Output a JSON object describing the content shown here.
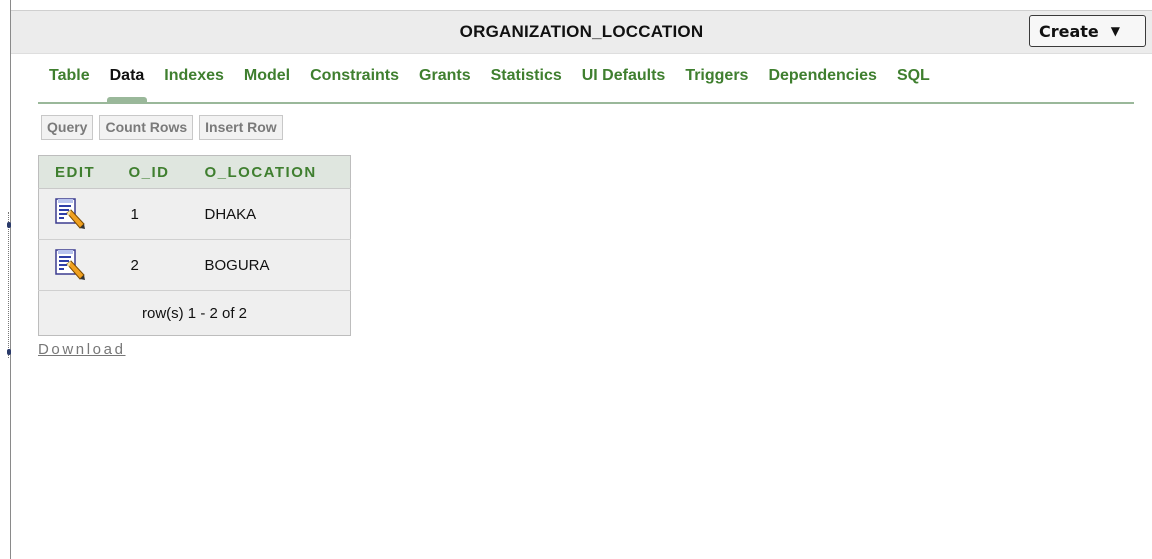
{
  "header": {
    "title": "ORGANIZATION_LOCCATION",
    "create_label": "Create"
  },
  "tabs": [
    {
      "label": "Table",
      "active": false
    },
    {
      "label": "Data",
      "active": true
    },
    {
      "label": "Indexes",
      "active": false
    },
    {
      "label": "Model",
      "active": false
    },
    {
      "label": "Constraints",
      "active": false
    },
    {
      "label": "Grants",
      "active": false
    },
    {
      "label": "Statistics",
      "active": false
    },
    {
      "label": "UI Defaults",
      "active": false
    },
    {
      "label": "Triggers",
      "active": false
    },
    {
      "label": "Dependencies",
      "active": false
    },
    {
      "label": "SQL",
      "active": false
    }
  ],
  "actions": {
    "query": "Query",
    "count_rows": "Count Rows",
    "insert_row": "Insert Row"
  },
  "report": {
    "columns": [
      "EDIT",
      "O_ID",
      "O_LOCATION"
    ],
    "rows": [
      {
        "o_id": "1",
        "o_location": "DHAKA"
      },
      {
        "o_id": "2",
        "o_location": "BOGURA"
      }
    ],
    "footer": "row(s) 1 - 2 of 2"
  },
  "download_label": "Download",
  "colors": {
    "tab_green": "#3f7f2f",
    "header_bg": "#ececec",
    "table_header_bg": "#dfe6df",
    "table_bg": "#efefef"
  },
  "icons": {
    "edit": "edit-document-pencil-icon",
    "dropdown": "caret-down-icon"
  }
}
